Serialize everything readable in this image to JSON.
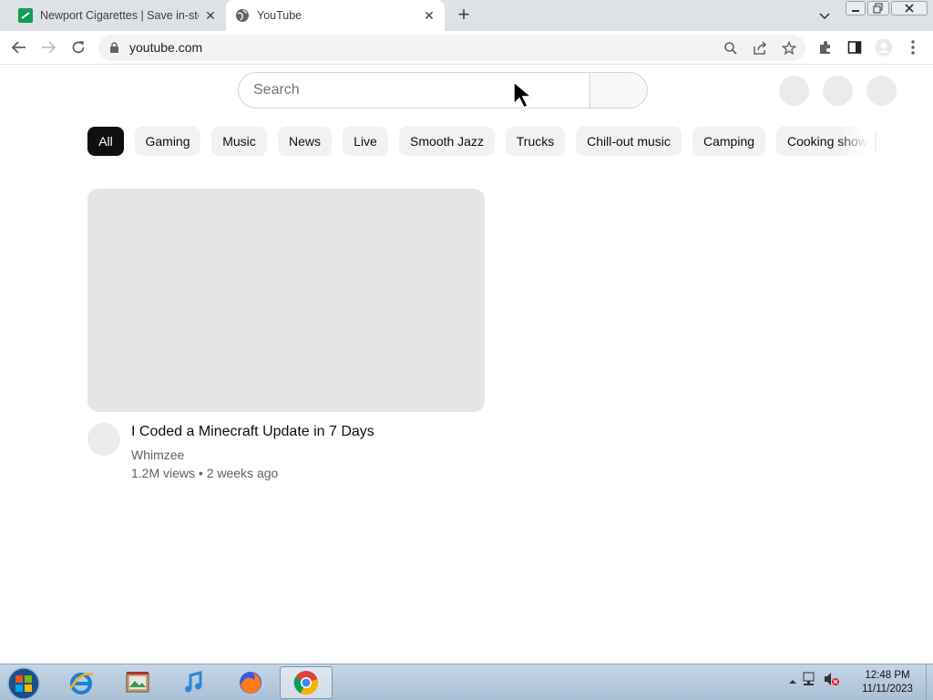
{
  "browser": {
    "tabs": [
      {
        "title": "Newport Cigarettes | Save in-store"
      },
      {
        "title": "YouTube"
      }
    ],
    "new_tab_symbol": "+",
    "close_symbol": "✕",
    "url": "youtube.com"
  },
  "youtube": {
    "search_placeholder": "Search",
    "chips": [
      "All",
      "Gaming",
      "Music",
      "News",
      "Live",
      "Smooth Jazz",
      "Trucks",
      "Chill-out music",
      "Camping",
      "Cooking shows"
    ],
    "video": {
      "title": "I Coded a Minecraft Update in 7 Days",
      "channel": "Whimzee",
      "meta": "1.2M views • 2 weeks ago"
    }
  },
  "taskbar": {
    "apps": [
      "internet-explorer",
      "image-viewer",
      "itunes",
      "firefox",
      "chrome"
    ],
    "clock": {
      "time": "12:48 PM",
      "date": "11/11/2023"
    }
  },
  "colors": {
    "chip_active": "#0f0f0f",
    "chip": "#f2f2f2",
    "tabstrip": "#dee1e6"
  }
}
